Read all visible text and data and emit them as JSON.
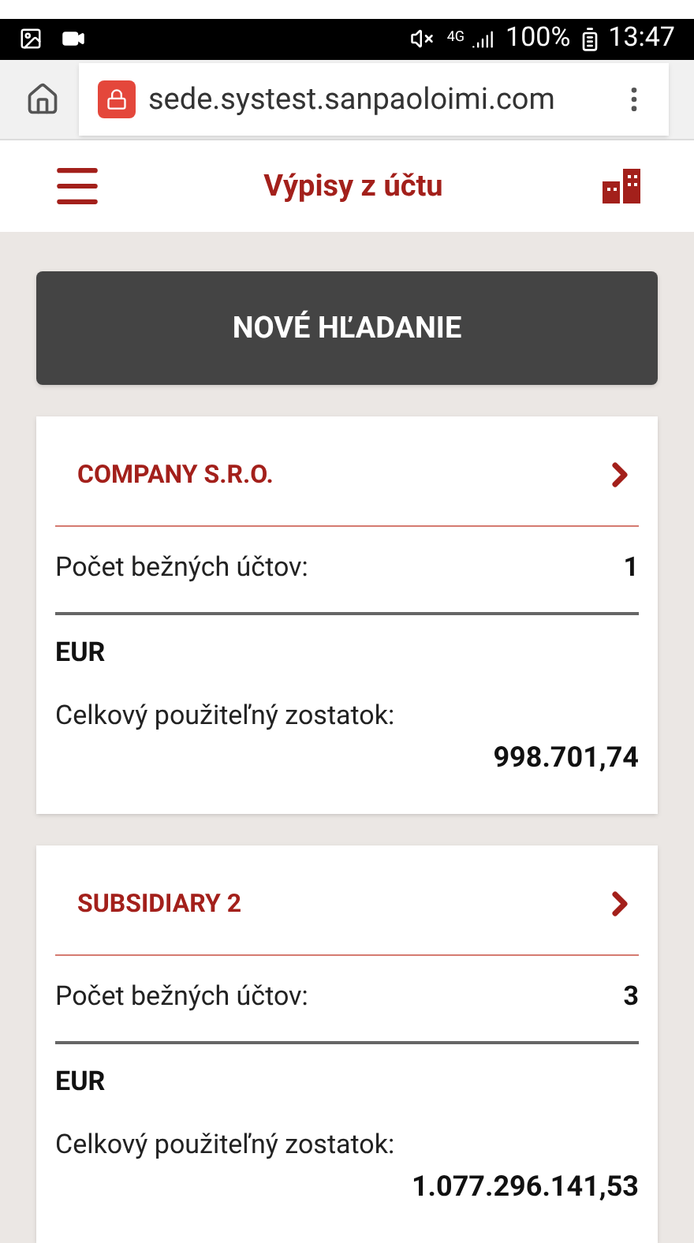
{
  "status_bar": {
    "battery": "100%",
    "time": "13:47",
    "network": "4G"
  },
  "browser": {
    "url": "sede.systest.sanpaoloimi.com"
  },
  "header": {
    "title": "Výpisy z účtu"
  },
  "new_search_button": "NOVÉ HĽADANIE",
  "companies": [
    {
      "name": "COMPANY S.R.O.",
      "accounts_label": "Počet bežných účtov:",
      "accounts_count": "1",
      "currency": "EUR",
      "balance_label": "Celkový použiteľný zostatok:",
      "balance": "998.701,74"
    },
    {
      "name": "SUBSIDIARY 2",
      "accounts_label": "Počet bežných účtov:",
      "accounts_count": "3",
      "currency": "EUR",
      "balance_label": "Celkový použiteľný zostatok:",
      "balance": "1.077.296.141,53"
    }
  ]
}
